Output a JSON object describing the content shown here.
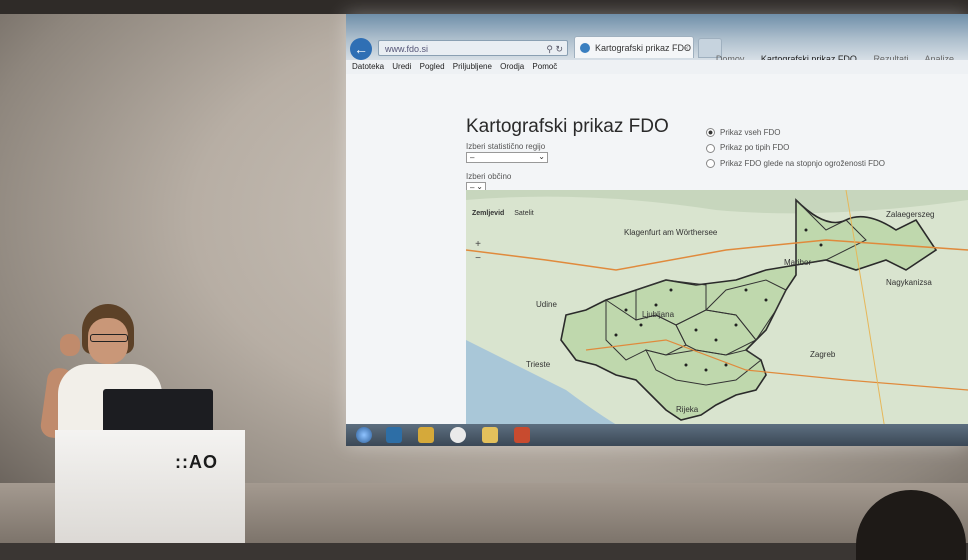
{
  "browser": {
    "address": "www.fdo.si",
    "tab_title": "Kartografski prikaz FDO | CRP",
    "menu": [
      "Datoteka",
      "Uredi",
      "Pogled",
      "Priljubljene",
      "Orodja",
      "Pomoč"
    ]
  },
  "site_nav": [
    "Domov",
    "Kartografski prikaz FDO",
    "Rezultati",
    "Analize"
  ],
  "page": {
    "title": "Kartografski prikaz FDO",
    "region_label": "Izberi statistično regijo",
    "region_value": "–",
    "municipality_label": "Izberi občino",
    "municipality_value": "–"
  },
  "radio_options": [
    {
      "label": "Prikaz vseh FDO",
      "selected": true
    },
    {
      "label": "Prikaz po tipih FDO",
      "selected": false
    },
    {
      "label": "Prikaz FDO glede na stopnjo ogroženosti FDO",
      "selected": false
    }
  ],
  "map": {
    "tabs": [
      "Zemljevid",
      "Satelit"
    ],
    "zoom_in": "+",
    "zoom_out": "−",
    "cities": [
      "Klagenfurt am Wörthersee",
      "Ljubljana",
      "Zagreb",
      "Nagykanizsa",
      "Zalaegerszeg",
      "Udine",
      "Maribor",
      "Rijeka",
      "Trieste"
    ]
  },
  "podium": {
    "logo": "::AO"
  }
}
